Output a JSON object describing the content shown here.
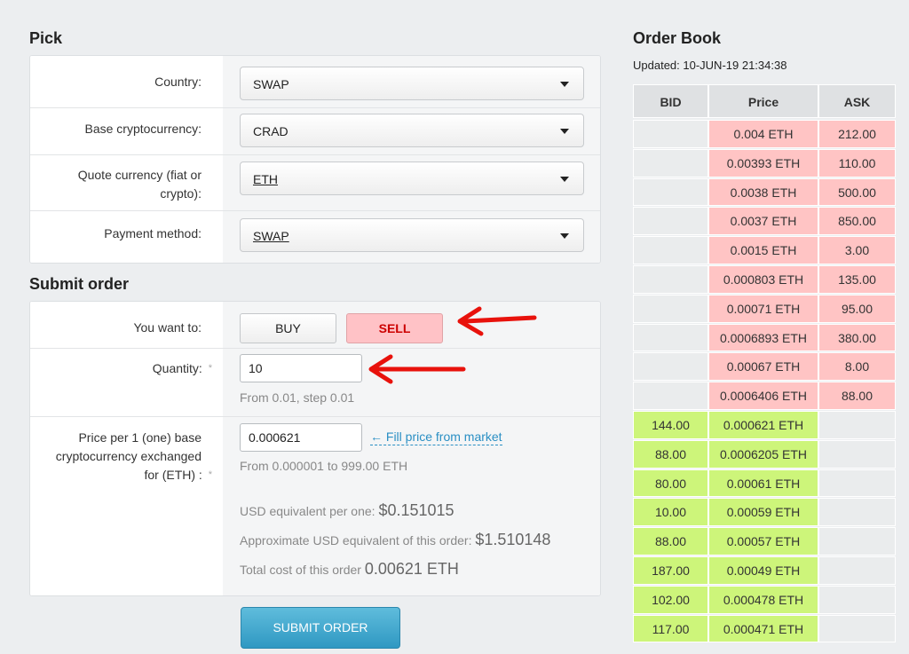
{
  "pick": {
    "heading": "Pick",
    "country": {
      "label": "Country:",
      "value": "SWAP"
    },
    "base": {
      "label": "Base cryptocurrency:",
      "value": "CRAD"
    },
    "quote": {
      "label_line1": "Quote currency (fiat or",
      "label_line2": "crypto):",
      "value": "ETH"
    },
    "payment": {
      "label": "Payment method:",
      "value": "SWAP"
    }
  },
  "order": {
    "heading": "Submit order",
    "want_label": "You want to:",
    "buy_label": "BUY",
    "sell_label": "SELL",
    "quantity_label": "Quantity:",
    "required_mark": "*",
    "quantity_value": "10",
    "quantity_hint": "From 0.01, step 0.01",
    "price_label_line1": "Price per 1 (one) base",
    "price_label_line2": "cryptocurrency exchanged",
    "price_label_line3": "for (ETH) :",
    "price_value": "0.000621",
    "fill_link": "← Fill price from market",
    "price_hint": "From 0.000001 to 999.00 ETH",
    "usd_per_one_label": "USD equivalent per one:",
    "usd_per_one_value": "$0.151015",
    "usd_total_label": "Approximate USD equivalent of this order:",
    "usd_total_value": "$1.510148",
    "total_cost_label": "Total cost of this order",
    "total_cost_value": "0.00621 ETH",
    "submit_label": "SUBMIT ORDER"
  },
  "order_book": {
    "heading": "Order Book",
    "updated": "Updated: 10-JUN-19 21:34:38",
    "headers": {
      "bid": "BID",
      "price": "Price",
      "ask": "ASK"
    },
    "asks": [
      {
        "price": "0.004 ETH",
        "ask": "212.00"
      },
      {
        "price": "0.00393 ETH",
        "ask": "110.00"
      },
      {
        "price": "0.0038 ETH",
        "ask": "500.00"
      },
      {
        "price": "0.0037 ETH",
        "ask": "850.00"
      },
      {
        "price": "0.0015 ETH",
        "ask": "3.00"
      },
      {
        "price": "0.000803 ETH",
        "ask": "135.00"
      },
      {
        "price": "0.00071 ETH",
        "ask": "95.00"
      },
      {
        "price": "0.0006893 ETH",
        "ask": "380.00"
      },
      {
        "price": "0.00067 ETH",
        "ask": "8.00"
      },
      {
        "price": "0.0006406 ETH",
        "ask": "88.00"
      }
    ],
    "bids": [
      {
        "bid": "144.00",
        "price": "0.000621 ETH"
      },
      {
        "bid": "88.00",
        "price": "0.0006205 ETH"
      },
      {
        "bid": "80.00",
        "price": "0.00061 ETH"
      },
      {
        "bid": "10.00",
        "price": "0.00059 ETH"
      },
      {
        "bid": "88.00",
        "price": "0.00057 ETH"
      },
      {
        "bid": "187.00",
        "price": "0.00049 ETH"
      },
      {
        "bid": "102.00",
        "price": "0.000478 ETH"
      },
      {
        "bid": "117.00",
        "price": "0.000471 ETH"
      }
    ]
  },
  "colors": {
    "ask_bg": "#ffc4c4",
    "bid_bg": "#cdf57a",
    "empty_bg": "#eaeced",
    "sell_bg": "#ffc2c6",
    "sell_text": "#cc0000",
    "accent": "#2f98c2",
    "annotation_arrow": "#e8120c"
  }
}
